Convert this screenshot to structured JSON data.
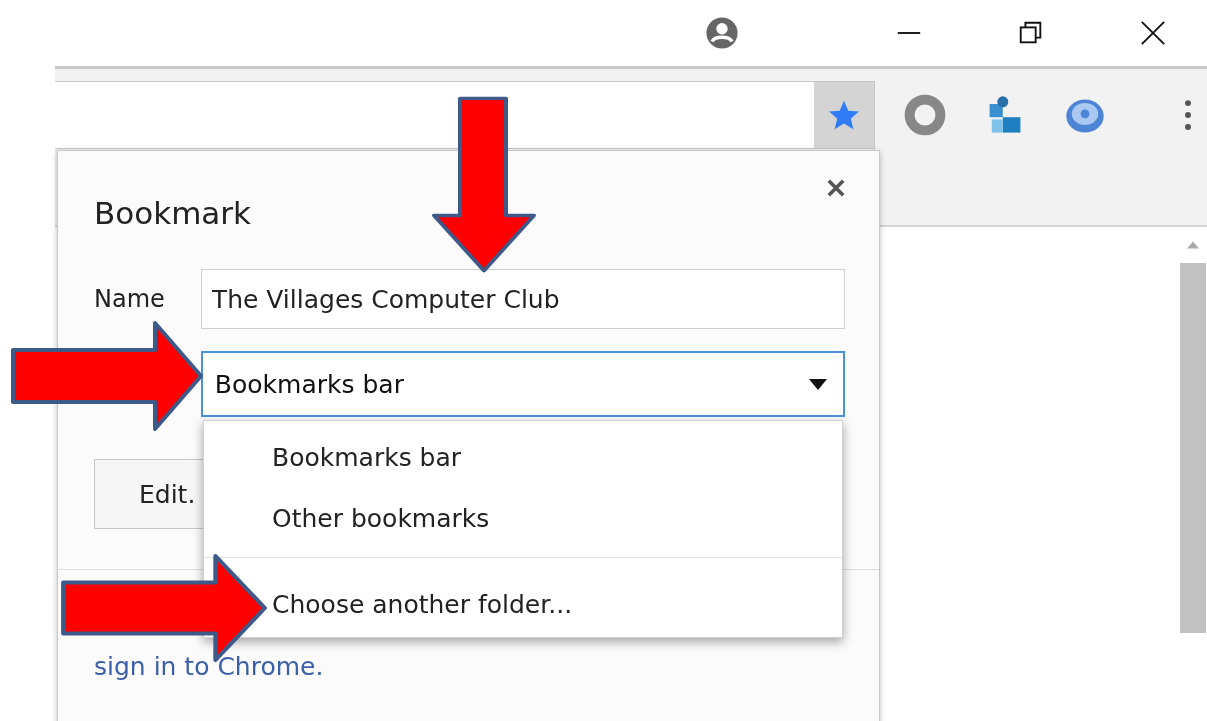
{
  "toolbar": {
    "bookmarked": true
  },
  "dialog": {
    "title": "Bookmark",
    "name_label": "Name",
    "name_value": "The Villages Computer Club",
    "folder_value": "Bookmarks bar",
    "edit_button": "Edit.",
    "signin_link": "sign in to Chrome."
  },
  "folder_menu": {
    "expanded": true,
    "groups": [
      [
        "Bookmarks bar",
        "Other bookmarks"
      ],
      [
        "Choose another folder..."
      ]
    ]
  },
  "annotations": [
    {
      "kind": "down"
    },
    {
      "kind": "right"
    },
    {
      "kind": "right"
    }
  ]
}
